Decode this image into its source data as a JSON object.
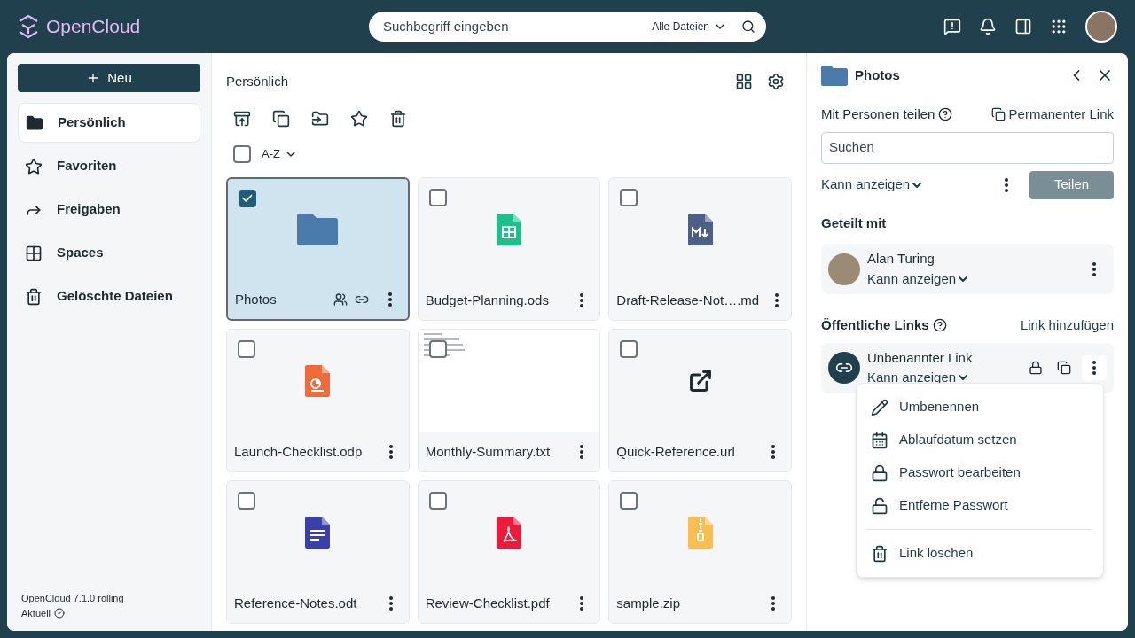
{
  "header": {
    "logo": "OpenCloud",
    "search": {
      "placeholder": "Suchbegriff eingeben",
      "scope": "Alle Dateien"
    }
  },
  "sidebar": {
    "new_button": "Neu",
    "items": [
      {
        "label": "Persönlich",
        "kind": "folder",
        "selected": true
      },
      {
        "label": "Favoriten",
        "kind": "star",
        "selected": false
      },
      {
        "label": "Freigaben",
        "kind": "share",
        "selected": false
      },
      {
        "label": "Spaces",
        "kind": "grid",
        "selected": false
      },
      {
        "label": "Gelöschte Dateien",
        "kind": "trash",
        "selected": false
      }
    ],
    "version": "OpenCloud 7.1.0 rolling",
    "status": "Aktuell"
  },
  "main": {
    "breadcrumb": "Persönlich",
    "select_all": {
      "checked": false
    },
    "sort": "A-Z",
    "files": [
      {
        "name": "Photos",
        "kind": "folder",
        "selected": true,
        "shared": true,
        "linked": true
      },
      {
        "name": "Budget-Planning.ods",
        "kind": "spreadsheet",
        "selected": false,
        "shared": false,
        "linked": false
      },
      {
        "name": "Draft-Release-Not….md",
        "kind": "markdown",
        "selected": false,
        "shared": false,
        "linked": false
      },
      {
        "name": "Launch-Checklist.odp",
        "kind": "presentation",
        "selected": false,
        "shared": false,
        "linked": false
      },
      {
        "name": "Monthly-Summary.txt",
        "kind": "text-preview",
        "selected": false,
        "shared": false,
        "linked": false
      },
      {
        "name": "Quick-Reference.url",
        "kind": "url",
        "selected": false,
        "shared": false,
        "linked": false
      },
      {
        "name": "Reference-Notes.odt",
        "kind": "document",
        "selected": false,
        "shared": false,
        "linked": false
      },
      {
        "name": "Review-Checklist.pdf",
        "kind": "pdf",
        "selected": false,
        "shared": false,
        "linked": false
      },
      {
        "name": "sample.zip",
        "kind": "archive",
        "selected": false,
        "shared": false,
        "linked": false
      }
    ]
  },
  "panel": {
    "title": "Photos",
    "share_label": "Mit Personen teilen",
    "permalink": "Permanenter Link",
    "search_placeholder": "Suchen",
    "role": "Kann anzeigen",
    "share_button": "Teilen",
    "shared_with_heading": "Geteilt mit",
    "shares": [
      {
        "name": "Alan Turing",
        "role": "Kann anzeigen"
      }
    ],
    "links_heading": "Öffentliche Links",
    "add_link": "Link hinzufügen",
    "links": [
      {
        "name": "Unbenannter Link",
        "role": "Kann anzeigen"
      }
    ],
    "menu": [
      {
        "label": "Umbenennen",
        "kind": "pencil",
        "separated": false
      },
      {
        "label": "Ablaufdatum setzen",
        "kind": "calendar",
        "separated": false
      },
      {
        "label": "Passwort bearbeiten",
        "kind": "lock",
        "separated": false
      },
      {
        "label": "Entferne Passwort",
        "kind": "unlock",
        "separated": false
      },
      {
        "label": "Link löschen",
        "kind": "trash",
        "separated": true
      }
    ]
  }
}
